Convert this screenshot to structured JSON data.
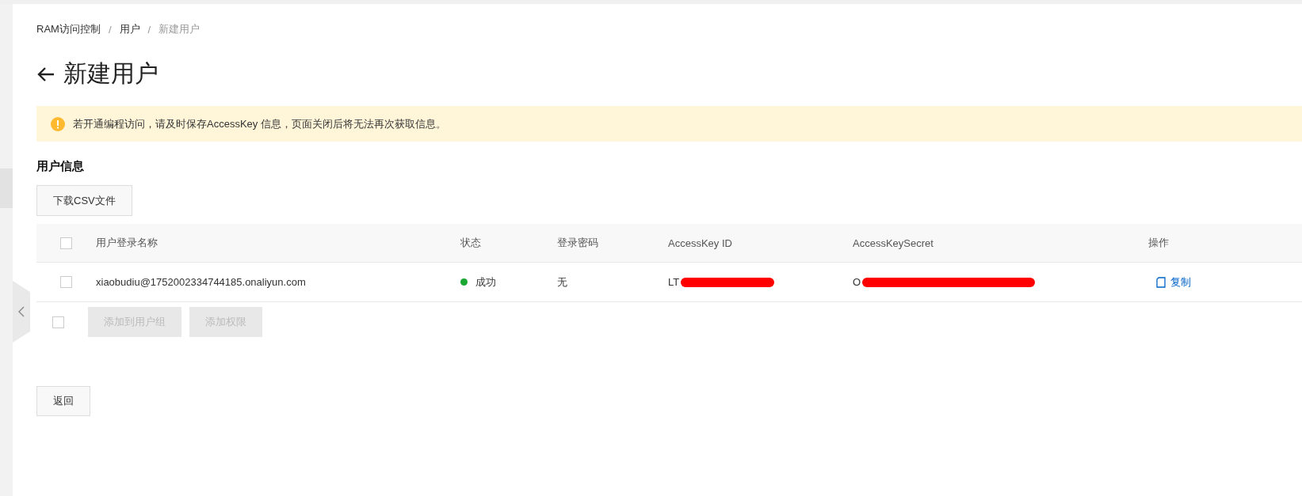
{
  "breadcrumb": [
    {
      "label": "RAM访问控制",
      "current": false
    },
    {
      "label": "用户",
      "current": false
    },
    {
      "label": "新建用户",
      "current": true
    }
  ],
  "breadcrumb_separator": "/",
  "page_title": "新建用户",
  "alert": {
    "kind": "warning",
    "text": "若开通编程访问，请及时保存AccessKey 信息，页面关闭后将无法再次获取信息。"
  },
  "section_title": "用户信息",
  "download_button": "下载CSV文件",
  "table": {
    "select_all": {
      "checked": false
    },
    "columns": [
      "用户登录名称",
      "状态",
      "登录密码",
      "AccessKey ID",
      "AccessKeySecret",
      "操作"
    ],
    "rows": [
      {
        "checked": false,
        "login_name": "xiaobudiu@1752002334744185.onaliyun.com",
        "status": {
          "text": "成功",
          "color": "#1aa832"
        },
        "password": "无",
        "accesskey_id": {
          "text": "LT",
          "redacted": true
        },
        "accesskey_secret": {
          "text": "O",
          "redacted": true
        },
        "action": "复制"
      }
    ],
    "footer": {
      "checked": false,
      "buttons": [
        {
          "label": "添加到用户组",
          "disabled": true
        },
        {
          "label": "添加权限",
          "disabled": true
        }
      ]
    }
  },
  "back_button": "返回"
}
